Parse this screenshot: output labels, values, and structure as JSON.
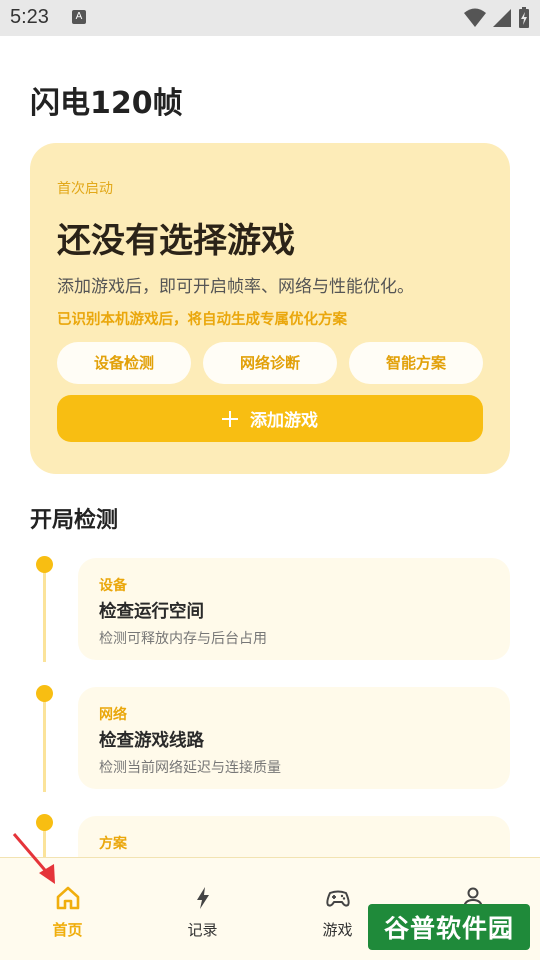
{
  "status_bar": {
    "time": "5:23",
    "notification_badge": "A"
  },
  "app": {
    "title": "闪电120帧"
  },
  "hero": {
    "tag": "首次启动",
    "title": "还没有选择游戏",
    "description": "添加游戏后，即可开启帧率、网络与性能优化。",
    "note": "已识别本机游戏后，将自动生成专属优化方案",
    "chips": [
      "设备检测",
      "网络诊断",
      "智能方案"
    ],
    "add_button": "添加游戏"
  },
  "detection": {
    "section_title": "开局检测",
    "items": [
      {
        "category": "设备",
        "title": "检查运行空间",
        "desc": "检测可释放内存与后台占用"
      },
      {
        "category": "网络",
        "title": "检查游戏线路",
        "desc": "检测当前网络延迟与连接质量"
      },
      {
        "category": "方案",
        "title": "",
        "desc": ""
      }
    ]
  },
  "bottom_nav": {
    "items": [
      {
        "label": "首页",
        "icon": "home-icon",
        "active": true
      },
      {
        "label": "记录",
        "icon": "lightning-icon",
        "active": false
      },
      {
        "label": "游戏",
        "icon": "gamepad-icon",
        "active": false
      },
      {
        "label": "",
        "icon": "profile-icon",
        "active": false
      }
    ]
  },
  "watermark": {
    "text": "谷普软件园"
  },
  "colors": {
    "accent": "#f8be12",
    "card": "#fdecb8",
    "timeline_card": "#fffaea"
  }
}
